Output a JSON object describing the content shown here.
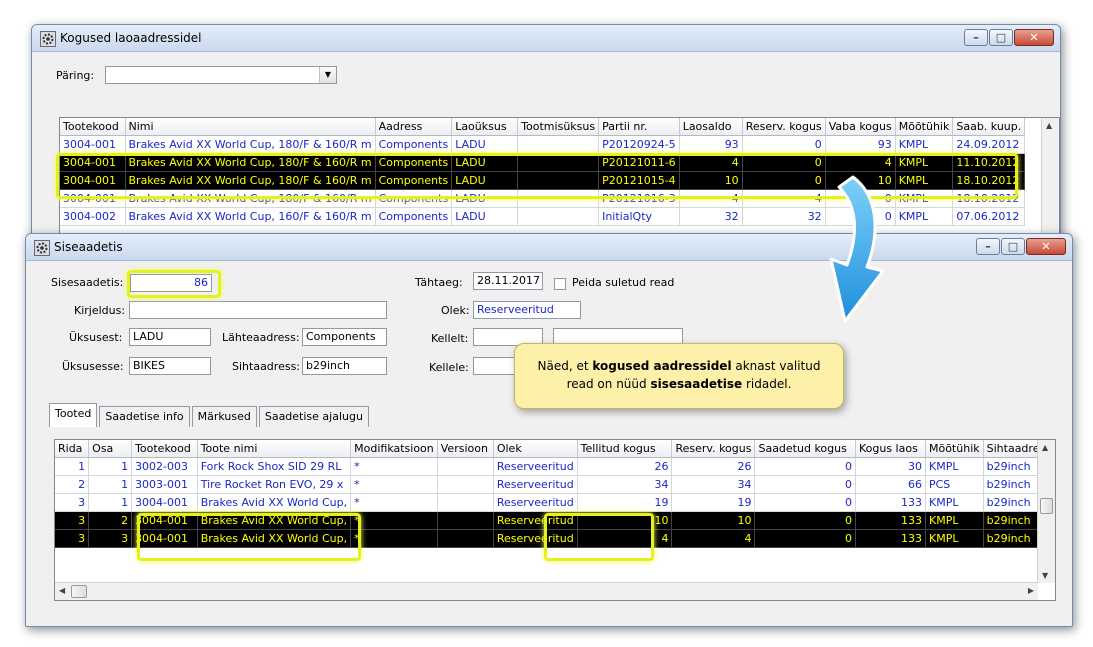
{
  "win1": {
    "title": "Kogused laoaadressidel",
    "query_label": "Päring:",
    "query_value": "",
    "columns": [
      "Tootekood",
      "Nimi",
      "Aadress",
      "Laoüksus",
      "Tootmisüksus",
      "Partii nr.",
      "Laosaldo",
      "Reserv. kogus",
      "Vaba kogus",
      "Mõõtühik",
      "Saab. kuup."
    ],
    "rows": [
      [
        "3004-001",
        "Brakes Avid XX World Cup, 180/F & 160/R m",
        "Components",
        "LADU",
        "",
        "P20120924-5",
        "93",
        "0",
        "93",
        "KMPL",
        "24.09.2012"
      ],
      [
        "3004-001",
        "Brakes Avid XX World Cup, 180/F & 160/R m",
        "Components",
        "LADU",
        "",
        "P20121011-6",
        "4",
        "0",
        "4",
        "KMPL",
        "11.10.2012"
      ],
      [
        "3004-001",
        "Brakes Avid XX World Cup, 180/F & 160/R m",
        "Components",
        "LADU",
        "",
        "P20121015-4",
        "10",
        "0",
        "10",
        "KMPL",
        "18.10.2012"
      ],
      [
        "3004-001",
        "Brakes Avid XX World Cup, 180/F & 160/R m",
        "Components",
        "LADU",
        "",
        "P20121016-3",
        "4",
        "4",
        "0",
        "KMPL",
        "18.10.2012"
      ],
      [
        "3004-002",
        "Brakes Avid XX World Cup, 160/F & 160/R m",
        "Components",
        "LADU",
        "",
        "InitialQty",
        "32",
        "32",
        "0",
        "KMPL",
        "07.06.2012"
      ]
    ]
  },
  "win2": {
    "title": "Siseaadetis",
    "sisesaadetis_label": "Sisesaadetis:",
    "sisesaadetis_value": "86",
    "kirjeldus_label": "Kirjeldus:",
    "kirjeldus_value": "",
    "uksusest_label": "Üksusest:",
    "uksusest_value": "LADU",
    "uksusesse_label": "Üksusesse:",
    "uksusesse_value": "BIKES",
    "lahteaadress_label": "Lähteaadress:",
    "lahteaadress_value": "Components",
    "sihtaadress_label": "Sihtaadress:",
    "sihtaadress_value": "b29inch",
    "tahtaeg_label": "Tähtaeg:",
    "tahtaeg_value": "28.11.2017",
    "peida_label": "Peida suletud read",
    "olek_label": "Olek:",
    "olek_value": "Reserveeritud",
    "kellelt_label": "Kellelt:",
    "kellele_label": "Kellele:",
    "tabs": [
      "Tooted",
      "Saadetise info",
      "Märkused",
      "Saadetise ajalugu"
    ],
    "columns": [
      "Rida",
      "Osa",
      "Tootekood",
      "Toote nimi",
      "Modifikatsioon",
      "Versioon",
      "Olek",
      "Tellitud kogus",
      "Reserv. kogus",
      "Saadetud kogus",
      "Kogus laos",
      "Mõõtühik",
      "Sihtaadress"
    ],
    "rows": [
      [
        "1",
        "1",
        "3002-003",
        "Fork Rock Shox SID 29 RL",
        "*",
        "",
        "Reserveeritud",
        "26",
        "26",
        "0",
        "30",
        "KMPL",
        "b29inch"
      ],
      [
        "2",
        "1",
        "3003-001",
        "Tire Rocket Ron EVO, 29 x",
        "*",
        "",
        "Reserveeritud",
        "34",
        "34",
        "0",
        "66",
        "PCS",
        "b29inch"
      ],
      [
        "3",
        "1",
        "3004-001",
        "Brakes Avid XX World Cup,",
        "*",
        "",
        "Reserveeritud",
        "19",
        "19",
        "0",
        "133",
        "KMPL",
        "b29inch"
      ],
      [
        "3",
        "2",
        "3004-001",
        "Brakes Avid XX World Cup,",
        "*",
        "",
        "Reserveeritud",
        "10",
        "10",
        "0",
        "133",
        "KMPL",
        "b29inch"
      ],
      [
        "3",
        "3",
        "3004-001",
        "Brakes Avid XX World Cup,",
        "*",
        "",
        "Reserveeritud",
        "4",
        "4",
        "0",
        "133",
        "KMPL",
        "b29inch"
      ]
    ]
  },
  "callout": {
    "t1": "Näed, et ",
    "t2": "kogused aadressidel",
    "t3": " aknast valitud",
    "t4": "read on nüüd ",
    "t5": "sisesaadetise",
    "t6": " ridadel."
  },
  "colors": {
    "selection_bg": "#000000",
    "selection_text": "#ffff00",
    "highlight": "#e5f21a",
    "arrow": "#2aa4e6",
    "callout_bg": "#fdf0a8"
  }
}
